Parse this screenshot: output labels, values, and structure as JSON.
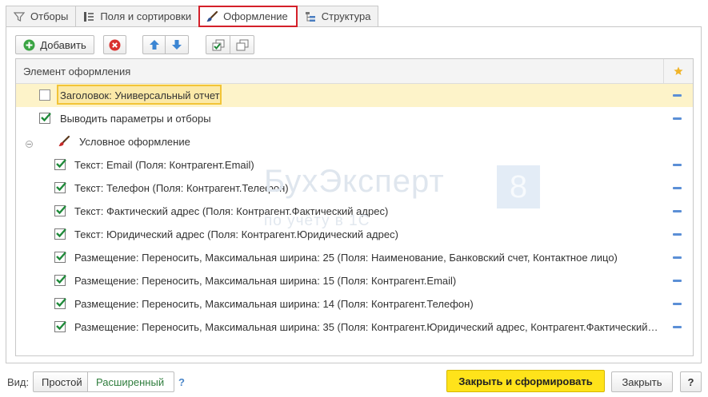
{
  "tabs": [
    {
      "label": "Отборы",
      "icon": "filter-icon"
    },
    {
      "label": "Поля и сортировки",
      "icon": "fields-sort-icon"
    },
    {
      "label": "Оформление",
      "icon": "brush-icon",
      "active": true
    },
    {
      "label": "Структура",
      "icon": "structure-icon"
    }
  ],
  "toolbar": {
    "add_label": "Добавить"
  },
  "grid": {
    "column_header": "Элемент оформления",
    "rows": [
      {
        "text": "Заголовок: Универсальный отчет",
        "checked": false,
        "selected": true
      },
      {
        "text": "Выводить параметры и отборы",
        "checked": true
      },
      {
        "text": "Условное оформление",
        "group": true,
        "expanded": true
      },
      {
        "text": "Текст: Email (Поля: Контрагент.Email)",
        "checked": true
      },
      {
        "text": "Текст: Телефон (Поля: Контрагент.Телефон)",
        "checked": true
      },
      {
        "text": "Текст: Фактический адрес (Поля: Контрагент.Фактический адрес)",
        "checked": true
      },
      {
        "text": "Текст: Юридический адрес (Поля: Контрагент.Юридический адрес)",
        "checked": true
      },
      {
        "text": "Размещение: Переносить, Максимальная ширина: 25 (Поля: Наименование, Банковский счет, Контактное лицо)",
        "checked": true
      },
      {
        "text": "Размещение: Переносить, Максимальная ширина: 15 (Поля: Контрагент.Email)",
        "checked": true
      },
      {
        "text": "Размещение: Переносить, Максимальная ширина: 14 (Поля: Контрагент.Телефон)",
        "checked": true
      },
      {
        "text": "Размещение: Переносить, Максимальная ширина: 35 (Поля: Контрагент.Юридический адрес, Контрагент.Фактический…",
        "checked": true
      }
    ]
  },
  "watermark": {
    "brand": "БухЭксперт",
    "number": "8",
    "tagline": "по учёту в 1С"
  },
  "footer": {
    "view_label": "Вид:",
    "view_simple": "Простой",
    "view_extended": "Расширенный",
    "help_mark": "?",
    "generate_label": "Закрыть и сформировать",
    "close_label": "Закрыть",
    "help_button": "?"
  },
  "colors": {
    "active_tab_border": "#d4202a",
    "selected_row": "#fdf3c9",
    "primary_button": "#ffe31a",
    "checkbox_mark": "#1f8a3a",
    "extended_view_text": "#2f7d3d"
  }
}
